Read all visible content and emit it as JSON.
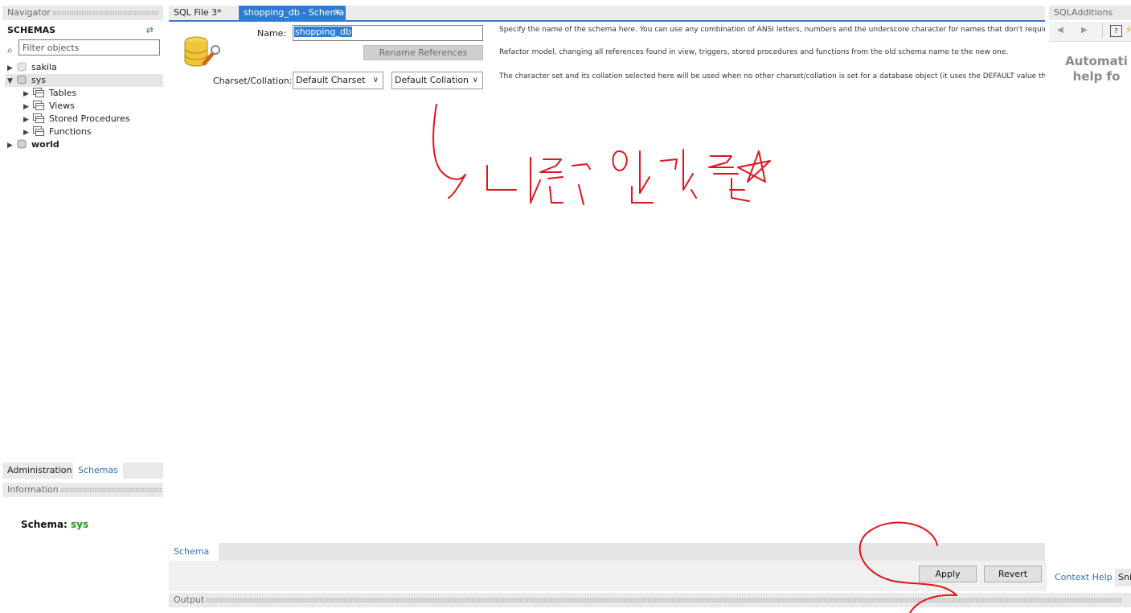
{
  "navigator": {
    "title": "Navigator",
    "schemas_header": "SCHEMAS",
    "filter_placeholder": "Filter objects",
    "tree": {
      "sakila": "sakila",
      "sys": "sys",
      "tables": "Tables",
      "views": "Views",
      "stored_procedures": "Stored Procedures",
      "functions": "Functions",
      "world": "world"
    },
    "tabs": [
      "Administration",
      "Schemas"
    ]
  },
  "information": {
    "title": "Information",
    "schema_label": "Schema:",
    "schema_value": "sys"
  },
  "editor": {
    "tabs": [
      "SQL File 3*",
      "shopping_db - Schema"
    ],
    "name_label": "Name:",
    "name_value": "shopping_db",
    "rename_button": "Rename References",
    "charset_label": "Charset/Collation:",
    "charset_value": "Default Charset",
    "collation_value": "Default Collation",
    "desc_name": "Specify the name of the schema here. You can use any combination of ANSI letters, numbers and the underscore character for names that don't require",
    "desc_refactor": "Refactor model, changing all references found in view, triggers, stored procedures and functions from the old schema name to the new one.",
    "desc_charset": "The character set and its collation selected here will be used when no other charset/collation is set for a database object (it uses the DEFAULT value then",
    "bottom_tab": "Schema",
    "apply_button": "Apply",
    "revert_button": "Revert"
  },
  "output": {
    "title": "Output"
  },
  "sql_additions": {
    "title": "SQLAdditions",
    "help_line1": "Automati",
    "help_line2": "help fo",
    "tabs": [
      "Context Help",
      "Sni"
    ]
  },
  "colors": {
    "accent": "#2d7dd2",
    "annotation": "#e0151b",
    "schema_value": "#1a9a1a",
    "link_tab": "#2c6fb8"
  }
}
